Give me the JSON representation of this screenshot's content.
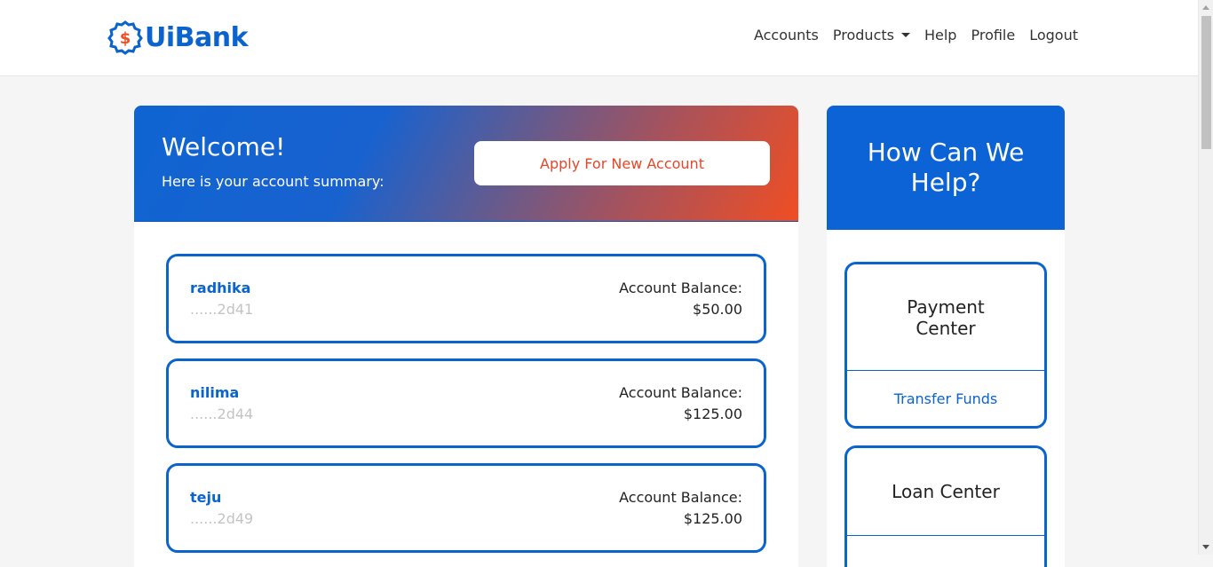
{
  "brand": {
    "name": "UiBank",
    "icon": "dollar-gear-icon",
    "color": "#0b63ce",
    "icon_accent": "#f04e23"
  },
  "nav": {
    "items": [
      {
        "label": "Accounts"
      },
      {
        "label": "Products",
        "has_dropdown": true
      },
      {
        "label": "Help"
      },
      {
        "label": "Profile"
      },
      {
        "label": "Logout"
      }
    ]
  },
  "welcome": {
    "title": "Welcome!",
    "subtitle": "Here is your account summary:",
    "apply_button": "Apply For New Account"
  },
  "accounts": [
    {
      "name": "radhika",
      "number": "......2d41",
      "balance_label": "Account Balance:",
      "balance": "$50.00"
    },
    {
      "name": "nilima",
      "number": "......2d44",
      "balance_label": "Account Balance:",
      "balance": "$125.00"
    },
    {
      "name": "teju",
      "number": "......2d49",
      "balance_label": "Account Balance:",
      "balance": "$125.00"
    }
  ],
  "help": {
    "title": "How Can We Help?",
    "services": [
      {
        "title": "Payment Center",
        "link": "Transfer Funds"
      },
      {
        "title": "Loan Center",
        "link": ""
      }
    ]
  },
  "colors": {
    "primary": "#0b63ce",
    "accent": "#f04e23",
    "page_bg": "#f5f5f5"
  }
}
